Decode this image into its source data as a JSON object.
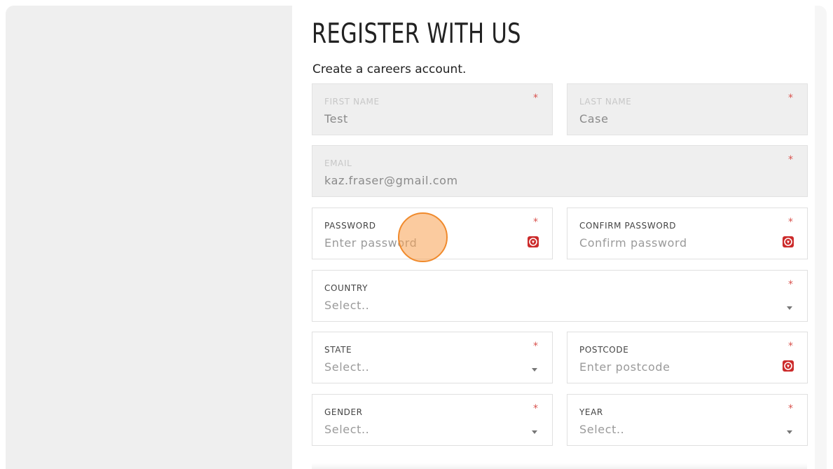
{
  "form": {
    "title": "REGISTER WITH US",
    "subtitle": "Create a careers account.",
    "required_mark": "*",
    "first_name": {
      "label": "FIRST NAME",
      "value": "Test"
    },
    "last_name": {
      "label": "LAST NAME",
      "value": "Case"
    },
    "email": {
      "label": "EMAIL",
      "value": "kaz.fraser@gmail.com"
    },
    "password": {
      "label": "PASSWORD",
      "placeholder": "Enter password"
    },
    "confirm_password": {
      "label": "CONFIRM PASSWORD",
      "placeholder": "Confirm password"
    },
    "country": {
      "label": "COUNTRY",
      "placeholder": "Select.."
    },
    "state": {
      "label": "STATE",
      "placeholder": "Select.."
    },
    "postcode": {
      "label": "POSTCODE",
      "placeholder": "Enter postcode"
    },
    "gender": {
      "label": "GENDER",
      "placeholder": "Select.."
    },
    "year": {
      "label": "YEAR",
      "placeholder": "Select.."
    }
  },
  "icons": {
    "password_manager": "password-manager-icon",
    "dropdown": "chevron-down-icon"
  },
  "colors": {
    "required": "#d9534f",
    "password_manager": "#cc2b2b",
    "cursor_highlight": "#f08a2c"
  }
}
